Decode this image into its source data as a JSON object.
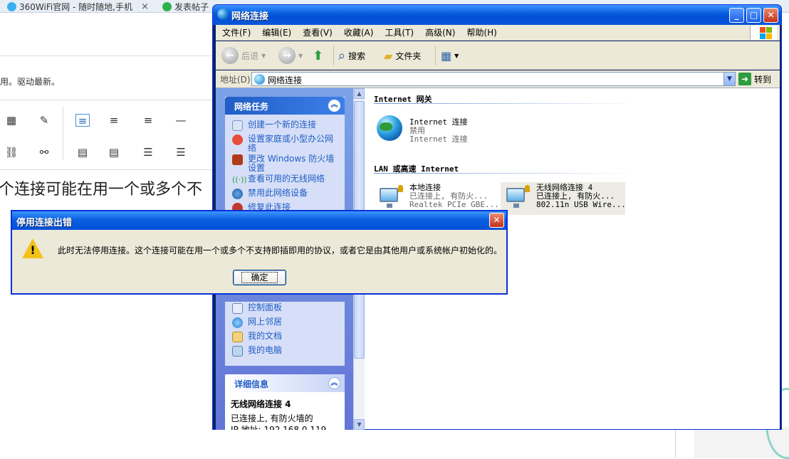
{
  "browser": {
    "tabs": [
      {
        "label": "360WiFi官网 - 随时随地,手机"
      },
      {
        "label": "发表帖子"
      }
    ],
    "tab_close": "×",
    "notice_text": "用。驱动最新。",
    "editor_text": "个连接可能在用一个或多个不"
  },
  "window": {
    "title": "网络连接",
    "controls": {
      "minimize": "_",
      "maximize": "□",
      "close": "✕"
    },
    "menu": [
      "文件(F)",
      "编辑(E)",
      "查看(V)",
      "收藏(A)",
      "工具(T)",
      "高级(N)",
      "帮助(H)"
    ],
    "toolbar": {
      "back": "后退",
      "search": "搜索",
      "folders": "文件夹"
    },
    "address": {
      "label": "地址(D)",
      "value": "网络连接",
      "go": "转到"
    }
  },
  "task_pane": {
    "network_tasks": {
      "title": "网络任务",
      "items": [
        {
          "label": "创建一个新的连接",
          "icon": "new-connection-icon"
        },
        {
          "label": "设置家庭或小型办公网络",
          "icon": "home-network-icon"
        },
        {
          "label": "更改 Windows 防火墙设置",
          "icon": "firewall-icon"
        },
        {
          "label": "查看可用的无线网络",
          "icon": "wireless-icon"
        },
        {
          "label": "禁用此网络设备",
          "icon": "disable-device-icon"
        },
        {
          "label": "修复此连接",
          "icon": "repair-icon"
        }
      ]
    },
    "other_places": {
      "items": [
        {
          "label": "控制面板",
          "icon": "control-panel-icon"
        },
        {
          "label": "网上邻居",
          "icon": "network-places-icon"
        },
        {
          "label": "我的文档",
          "icon": "my-documents-icon"
        },
        {
          "label": "我的电脑",
          "icon": "my-computer-icon"
        }
      ]
    },
    "details": {
      "title": "详细信息",
      "name": "无线网络连接 4",
      "status": "已连接上, 有防火墙的",
      "ip": "IP 地址: 192.168.0.119"
    }
  },
  "groups": {
    "gateway": {
      "title": "Internet 网关",
      "items": [
        {
          "name": "Internet 连接",
          "status": "禁用",
          "device": "Internet 连接"
        }
      ]
    },
    "lan": {
      "title": "LAN 或高速 Internet",
      "items": [
        {
          "name": "本地连接",
          "status": "已连接上, 有防火...",
          "device": "Realtek PCIe GBE..."
        },
        {
          "name": "无线网络连接 4",
          "status": "已连接上, 有防火...",
          "device": "802.11n USB Wire..."
        }
      ]
    }
  },
  "dialog": {
    "title": "停用连接出错",
    "message": "此时无法停用连接。这个连接可能在用一个或多个不支持即插即用的协议，或者它是由其他用户或系统帐户初始化的。",
    "ok": "确定",
    "close": "✕"
  },
  "colors": {
    "xp_blue": "#0a5fe0",
    "task_link": "#215dc6",
    "dialog_bg": "#ece9d8"
  }
}
